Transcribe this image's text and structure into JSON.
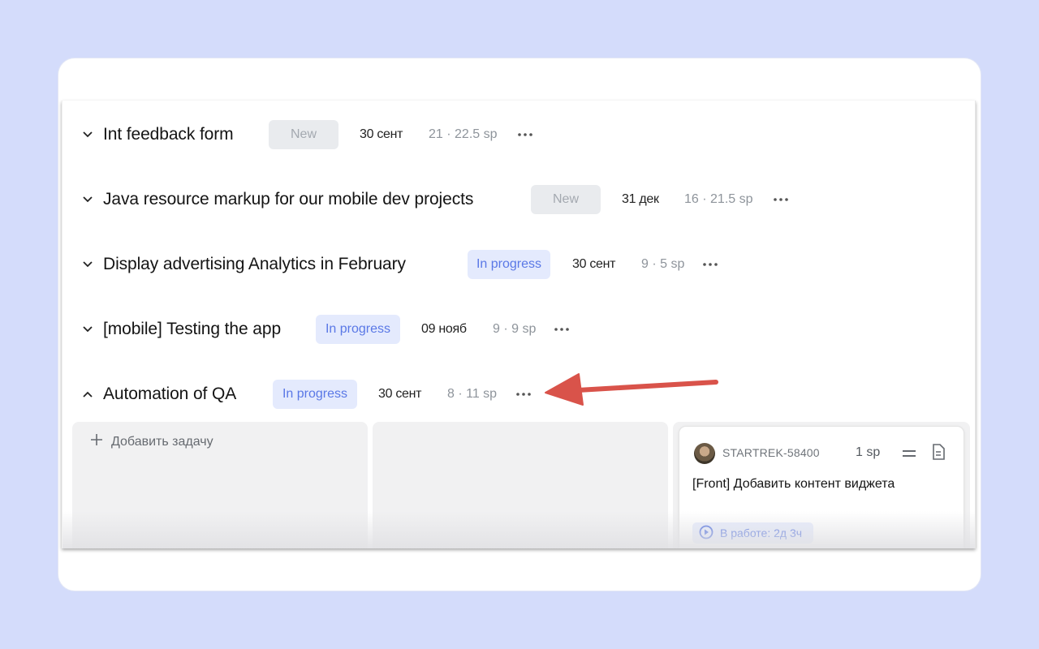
{
  "epics": [
    {
      "title": "Int feedback form",
      "status": "New",
      "date": "30 сент",
      "sp": "21 · 22.5 sp",
      "expanded": false
    },
    {
      "title": "Java resource markup for  our mobile dev projects",
      "status": "New",
      "date": "31 дек",
      "sp": "16 · 21.5 sp",
      "expanded": false
    },
    {
      "title": "Display advertising Analytics in February",
      "status": "In progress",
      "date": "30 сент",
      "sp": "9 · 5 sp",
      "expanded": false
    },
    {
      "title": "[mobile] Testing the app",
      "status": "In progress",
      "date": "09 нояб",
      "sp": "9 · 9 sp",
      "expanded": false
    },
    {
      "title": "Automation of QA",
      "status": "In progress",
      "date": "30 сент",
      "sp": "8 · 11 sp",
      "expanded": true
    }
  ],
  "board": {
    "add_task_label": "Добавить задачу",
    "task": {
      "key": "STARTREK-58400",
      "sp": "1 sp",
      "title": "[Front] Добавить контент виджета",
      "status": "В работе: 2д 3ч"
    }
  },
  "icons": {
    "collapse": "chevron-down-icon",
    "expand": "chevron-up-icon",
    "more": "more-horizontal-icon",
    "add": "plus-icon",
    "priority": "priority-equal-icon",
    "document": "document-icon",
    "play": "play-circle-icon"
  },
  "colors": {
    "background": "#d4dcfb",
    "badge_new_bg": "#e9ebee",
    "badge_new_text": "#a4a9b0",
    "badge_progress_bg": "#e4eafd",
    "badge_progress_text": "#5a78e6",
    "annotation_arrow": "#d9534a"
  }
}
